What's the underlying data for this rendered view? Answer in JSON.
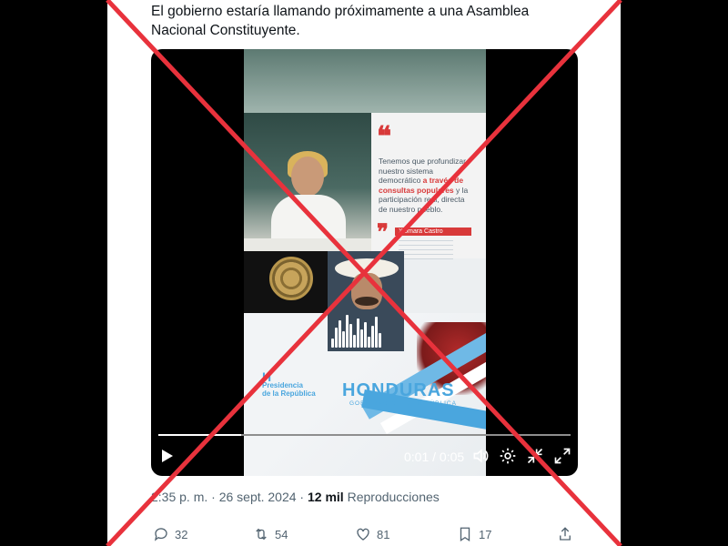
{
  "tweet": {
    "text": "El gobierno estaría llamando próximamente a una Asamblea Nacional Constituyente."
  },
  "video": {
    "quote_line1": "Tenemos que profundizar nuestro sistema democrático ",
    "quote_highlight": "a través de consultas populares",
    "quote_line2": " y la participación real, directa de nuestro pueblo.",
    "quote_author": "Xiomara Castro",
    "president_logo_line1": "Presidencia",
    "president_logo_line2": "de la República",
    "brand_title": "HONDURAS",
    "brand_subtitle": "GOBIERNO DE LA REPÚBLICA",
    "progress_fraction": 0.2,
    "current_time": "0:01",
    "duration": "0:05",
    "time_separator": " / "
  },
  "meta": {
    "timestamp": "2:35 p. m. · 26 sept. 2024 · ",
    "views_count": "12 mil",
    "views_label": " Reproducciones"
  },
  "actions": {
    "replies": "32",
    "reposts": "54",
    "likes": "81",
    "bookmarks": "17"
  },
  "colors": {
    "cross": "#e8323c",
    "brand_blue": "#4aa6de",
    "quote_red": "#d83a3a",
    "muted_text": "#536471"
  },
  "icons": [
    "play-icon",
    "volume-icon",
    "settings-icon",
    "minimize-icon",
    "fullscreen-icon",
    "reply-icon",
    "repost-icon",
    "like-icon",
    "bookmark-icon",
    "share-icon"
  ]
}
